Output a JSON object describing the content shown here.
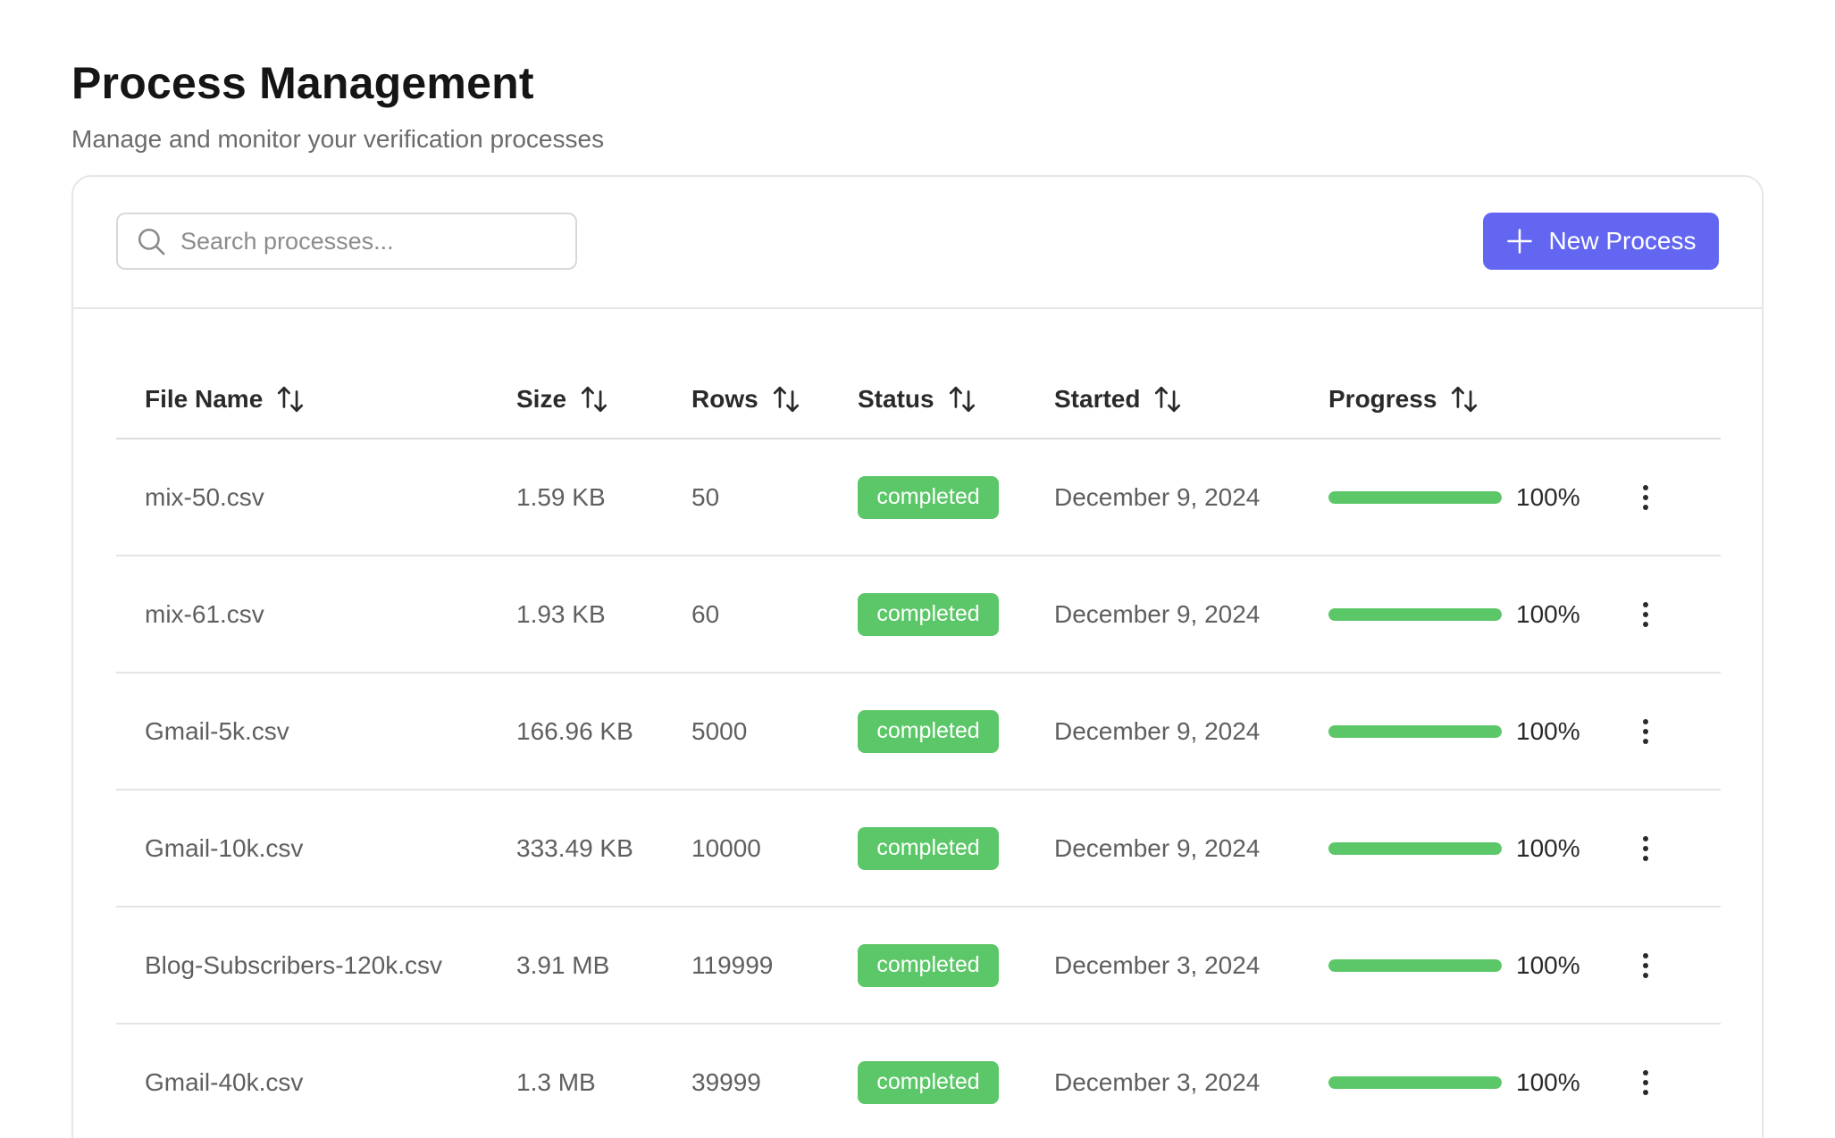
{
  "header": {
    "title": "Process Management",
    "subtitle": "Manage and monitor your verification processes"
  },
  "toolbar": {
    "search_placeholder": "Search processes...",
    "new_button_label": "New Process",
    "accent_color": "#6366f1"
  },
  "table": {
    "columns": [
      {
        "key": "name",
        "label": "File Name"
      },
      {
        "key": "size",
        "label": "Size"
      },
      {
        "key": "rows",
        "label": "Rows"
      },
      {
        "key": "status",
        "label": "Status"
      },
      {
        "key": "started",
        "label": "Started"
      },
      {
        "key": "progress",
        "label": "Progress"
      }
    ],
    "status_color": "#5cc768",
    "rows": [
      {
        "name": "mix-50.csv",
        "size": "1.59 KB",
        "rows": "50",
        "status": "completed",
        "started": "December 9, 2024",
        "progress": 100,
        "progress_label": "100%"
      },
      {
        "name": "mix-61.csv",
        "size": "1.93 KB",
        "rows": "60",
        "status": "completed",
        "started": "December 9, 2024",
        "progress": 100,
        "progress_label": "100%"
      },
      {
        "name": "Gmail-5k.csv",
        "size": "166.96 KB",
        "rows": "5000",
        "status": "completed",
        "started": "December 9, 2024",
        "progress": 100,
        "progress_label": "100%"
      },
      {
        "name": "Gmail-10k.csv",
        "size": "333.49 KB",
        "rows": "10000",
        "status": "completed",
        "started": "December 9, 2024",
        "progress": 100,
        "progress_label": "100%"
      },
      {
        "name": "Blog-Subscribers-120k.csv",
        "size": "3.91 MB",
        "rows": "119999",
        "status": "completed",
        "started": "December 3, 2024",
        "progress": 100,
        "progress_label": "100%"
      },
      {
        "name": "Gmail-40k.csv",
        "size": "1.3 MB",
        "rows": "39999",
        "status": "completed",
        "started": "December 3, 2024",
        "progress": 100,
        "progress_label": "100%"
      }
    ]
  }
}
